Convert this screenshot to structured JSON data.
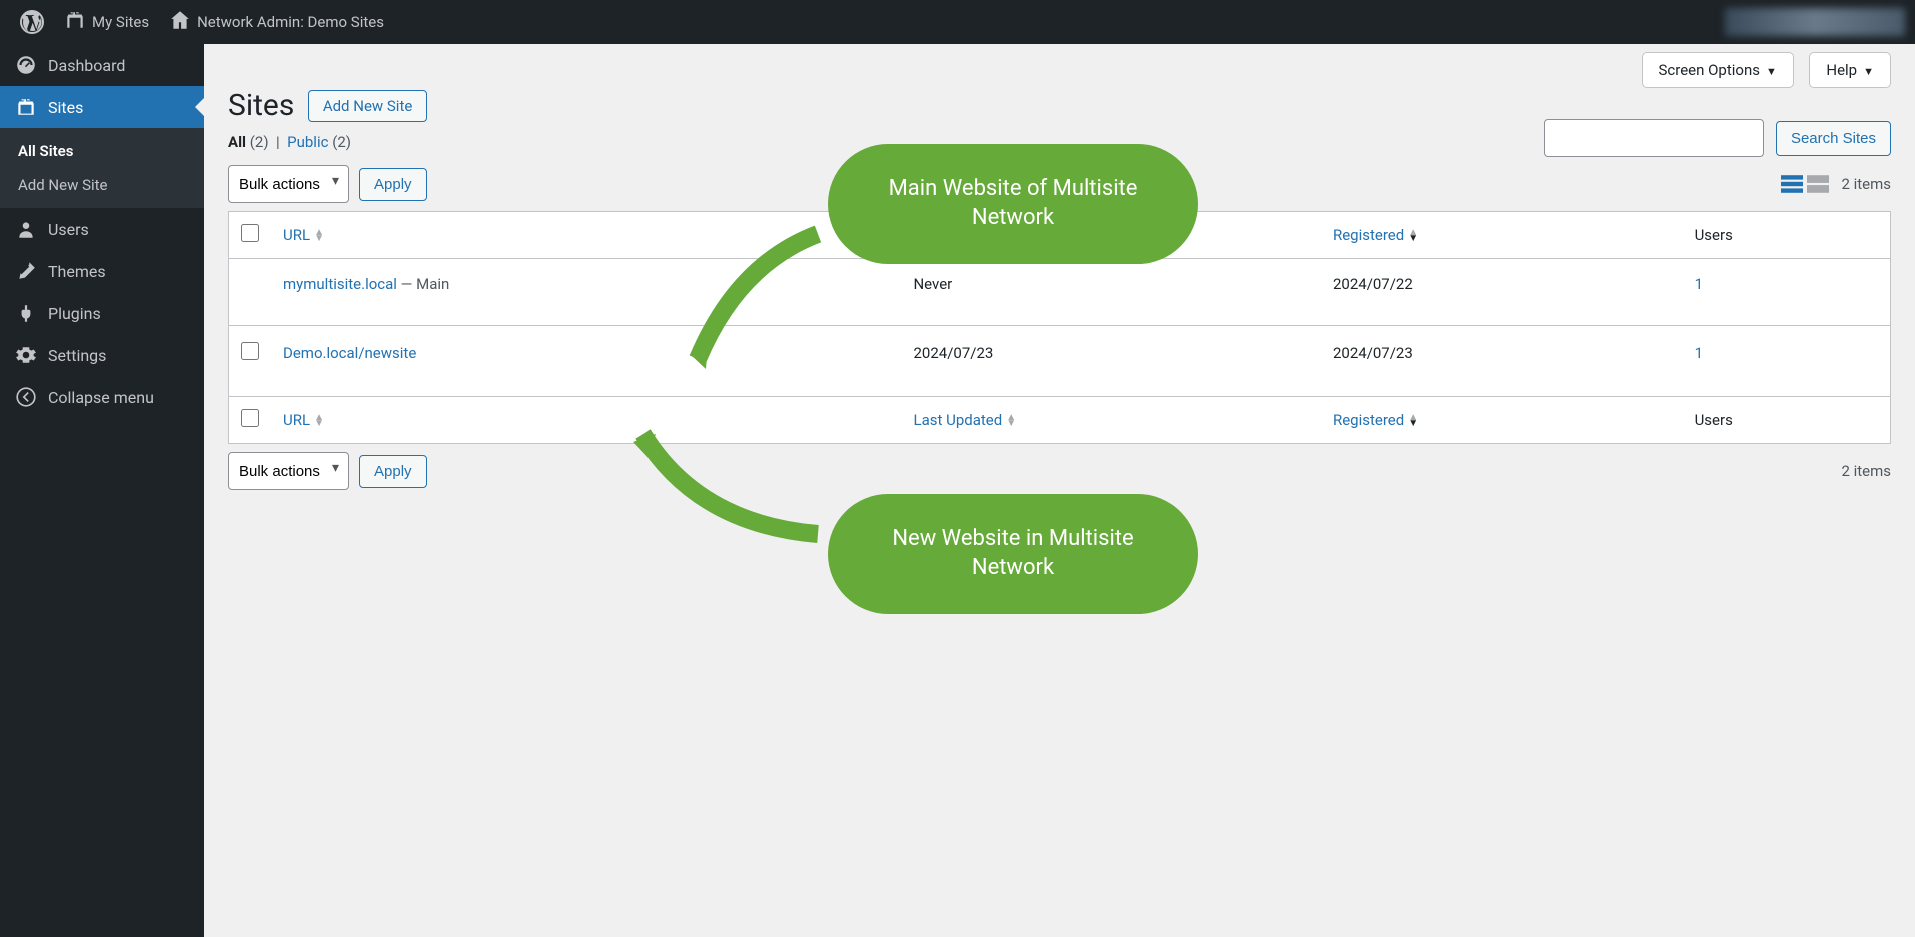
{
  "adminbar": {
    "mysites": "My Sites",
    "sitename": "Network Admin: Demo Sites"
  },
  "menu": {
    "dashboard": "Dashboard",
    "sites": "Sites",
    "users": "Users",
    "themes": "Themes",
    "plugins": "Plugins",
    "settings": "Settings",
    "collapse": "Collapse menu"
  },
  "submenu": {
    "all_sites": "All Sites",
    "add_new": "Add New Site"
  },
  "screen_meta": {
    "screen_options": "Screen Options",
    "help": "Help"
  },
  "page": {
    "title": "Sites",
    "add_new": "Add New Site"
  },
  "subsubsub": {
    "all": "All",
    "all_count": "(2)",
    "sep": "|",
    "public": "Public",
    "public_count": "(2)"
  },
  "search": {
    "button": "Search Sites"
  },
  "bulk": {
    "label": "Bulk actions",
    "apply": "Apply"
  },
  "tablenav": {
    "items": "2 items"
  },
  "columns": {
    "url": "URL",
    "last_updated": "Last Updated",
    "registered": "Registered",
    "users": "Users"
  },
  "rows": [
    {
      "url": "mymultisite.local",
      "url_suffix": " — Main",
      "last_updated": "Never",
      "registered": "2024/07/22",
      "users": "1",
      "has_checkbox": false
    },
    {
      "url": "Demo.local/newsite",
      "url_suffix": "",
      "last_updated": "2024/07/23",
      "registered": "2024/07/23",
      "users": "1",
      "has_checkbox": true
    }
  ],
  "callouts": {
    "c1": "Main Website of Multisite Network",
    "c2": "New Website in Multisite Network"
  }
}
